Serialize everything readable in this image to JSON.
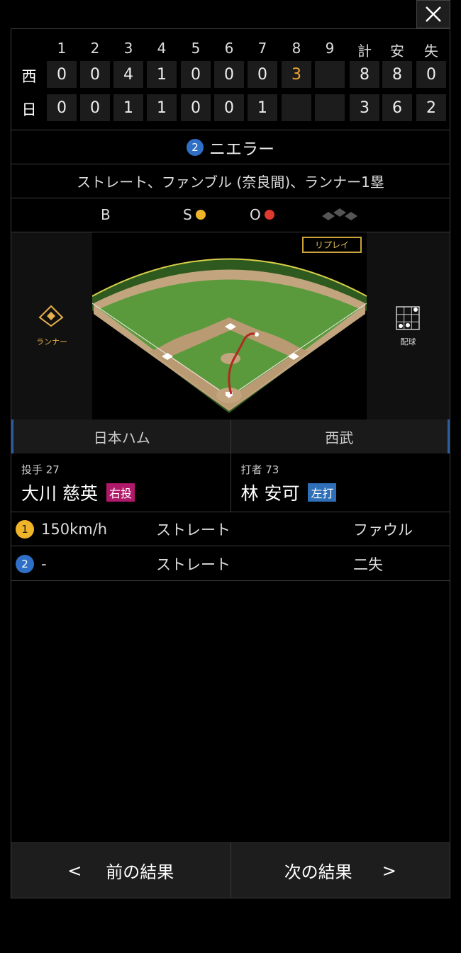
{
  "scoreboard": {
    "headers": [
      "1",
      "2",
      "3",
      "4",
      "5",
      "6",
      "7",
      "8",
      "9",
      "計",
      "安",
      "失"
    ],
    "rows": [
      {
        "team": "西",
        "cells": [
          "0",
          "0",
          "4",
          "1",
          "0",
          "0",
          "0",
          "3",
          "",
          "8",
          "8",
          "0"
        ]
      },
      {
        "team": "日",
        "cells": [
          "0",
          "0",
          "1",
          "1",
          "0",
          "0",
          "1",
          "",
          "",
          "3",
          "6",
          "2"
        ]
      }
    ]
  },
  "play": {
    "number": "2",
    "result": "ニエラー",
    "description": "ストレート、ファンブル (奈良間)、ランナー1塁"
  },
  "count": {
    "b_label": "B",
    "s_label": "S",
    "o_label": "O",
    "strikes": 1,
    "outs": 1
  },
  "field": {
    "replay_label": "リプレイ",
    "runner_label": "ランナー",
    "pitch_label": "配球"
  },
  "teams": {
    "left": "日本ハム",
    "right": "西武"
  },
  "pitcher": {
    "sub": "投手 27",
    "name": "大川 慈英",
    "tag": "右投"
  },
  "batter": {
    "sub": "打者 73",
    "name": "林 安可",
    "tag": "左打"
  },
  "pitches": [
    {
      "num": "1",
      "speed": "150km/h",
      "type": "ストレート",
      "result": "ファウル",
      "color": "#f0b429"
    },
    {
      "num": "2",
      "speed": "-",
      "type": "ストレート",
      "result": "二失",
      "color": "#2f6fc6"
    }
  ],
  "nav": {
    "prev": "前の結果",
    "next": "次の結果"
  },
  "colors": {
    "strike": "#f0b429",
    "out": "#e03a2e",
    "pitcher_tag": "#b0186a",
    "batter_tag": "#2e6fb8"
  }
}
